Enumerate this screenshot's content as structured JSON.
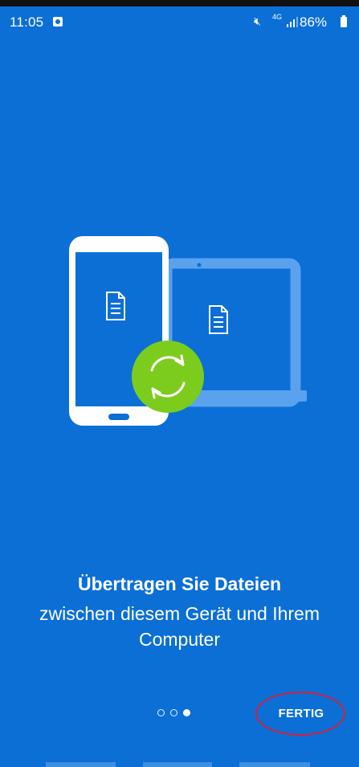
{
  "status_bar": {
    "time": "11:05",
    "network": "4G",
    "battery": "86%"
  },
  "slide": {
    "headline": "Übertragen Sie Dateien",
    "subline": "zwischen diesem Gerät und Ihrem Computer"
  },
  "pager": {
    "count": 3,
    "active_index": 2
  },
  "done_button": {
    "label": "FERTIG"
  },
  "colors": {
    "background": "#0b6fd6",
    "accent_green": "#7ccc1d",
    "annotation": "#d1213b"
  },
  "icons": [
    "mute-icon",
    "signal-icon",
    "battery-icon",
    "document-icon",
    "sync-icon"
  ]
}
